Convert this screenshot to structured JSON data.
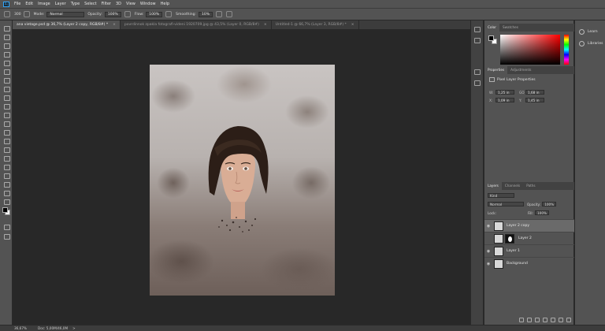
{
  "menubar": {
    "logo": "Ps",
    "items": [
      "File",
      "Edit",
      "Image",
      "Layer",
      "Type",
      "Select",
      "Filter",
      "3D",
      "View",
      "Window",
      "Help"
    ]
  },
  "options": {
    "size": "300",
    "mode_label": "Mode:",
    "mode_value": "Normal",
    "opacity_label": "Opacity:",
    "opacity_value": "100%",
    "flow_label": "Flow:",
    "flow_value": "100%",
    "smoothing_label": "Smoothing:",
    "smoothing_value": "10%"
  },
  "tabs": [
    {
      "label": "ana vietage.psd @ 36,7% (Layer 2 copy, RGB/8#) *",
      "close": "×"
    },
    {
      "label": "povrdinnok zpakla fotografi-videni 1920709.jpg @ 43,5% (Layer 0, RGB/8#)",
      "close": "×"
    },
    {
      "label": "Untitled-1 @ 66,7% (Layer 3, RGB/8#) *",
      "close": "×"
    }
  ],
  "color_panel": {
    "tabs": [
      "Color",
      "Swatches"
    ],
    "picker_hue": "#ff0000"
  },
  "properties": {
    "tabs": [
      "Properties",
      "Adjustments"
    ],
    "title": "Pixel Layer Properties",
    "fields": [
      {
        "label": "W:",
        "value": "1,25 in"
      },
      {
        "label": "GO",
        "value": "1,68 in"
      },
      {
        "label": "X:",
        "value": "1,09 in"
      },
      {
        "label": "Y:",
        "value": "1,45 in"
      }
    ]
  },
  "layers": {
    "tabs": [
      "Layers",
      "Channels",
      "Paths"
    ],
    "kind_label": "Kind",
    "blend_mode": "Normal",
    "opacity_label": "Opacity:",
    "opacity_value": "100%",
    "lock_label": "Lock:",
    "fill_label": "Fill:",
    "fill_value": "100%",
    "items": [
      {
        "name": "Layer 2 copy"
      },
      {
        "name": "Layer 2"
      },
      {
        "name": "Layer 1"
      },
      {
        "name": "Background"
      }
    ]
  },
  "learn_panel": {
    "items": [
      "Learn",
      "Libraries"
    ]
  },
  "status": {
    "zoom": "36,67%",
    "doc": "Doc: 5,00M/46,0M",
    "arrow": ">"
  }
}
